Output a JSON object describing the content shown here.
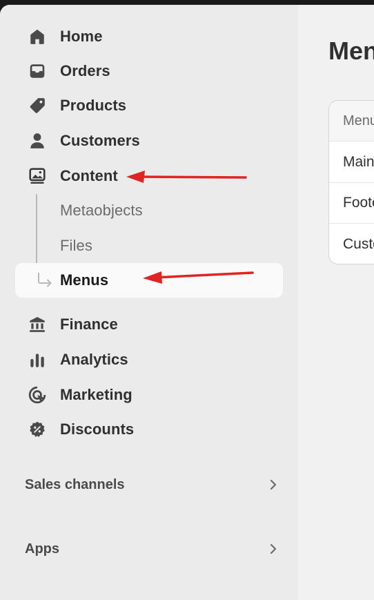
{
  "sidebar": {
    "items": [
      {
        "label": "Home",
        "icon": "home-icon"
      },
      {
        "label": "Orders",
        "icon": "inbox-icon"
      },
      {
        "label": "Products",
        "icon": "tag-icon"
      },
      {
        "label": "Customers",
        "icon": "person-icon"
      },
      {
        "label": "Content",
        "icon": "image-icon"
      }
    ],
    "content_children": [
      {
        "label": "Metaobjects"
      },
      {
        "label": "Files"
      },
      {
        "label": "Menus"
      }
    ],
    "items2": [
      {
        "label": "Finance",
        "icon": "bank-icon"
      },
      {
        "label": "Analytics",
        "icon": "bar-chart-icon"
      },
      {
        "label": "Marketing",
        "icon": "target-icon"
      },
      {
        "label": "Discounts",
        "icon": "discount-badge-icon"
      }
    ],
    "sections": [
      {
        "label": "Sales channels"
      },
      {
        "label": "Apps"
      }
    ]
  },
  "main": {
    "title": "Menus",
    "table": {
      "header": "Menu",
      "rows": [
        "Main menu",
        "Footer menu",
        "Customer account"
      ]
    }
  },
  "colors": {
    "sidebar_bg": "#ebebeb",
    "main_bg": "#f1f1f1",
    "active_bg": "#fafafa",
    "annotation_arrow": "#e02424"
  }
}
